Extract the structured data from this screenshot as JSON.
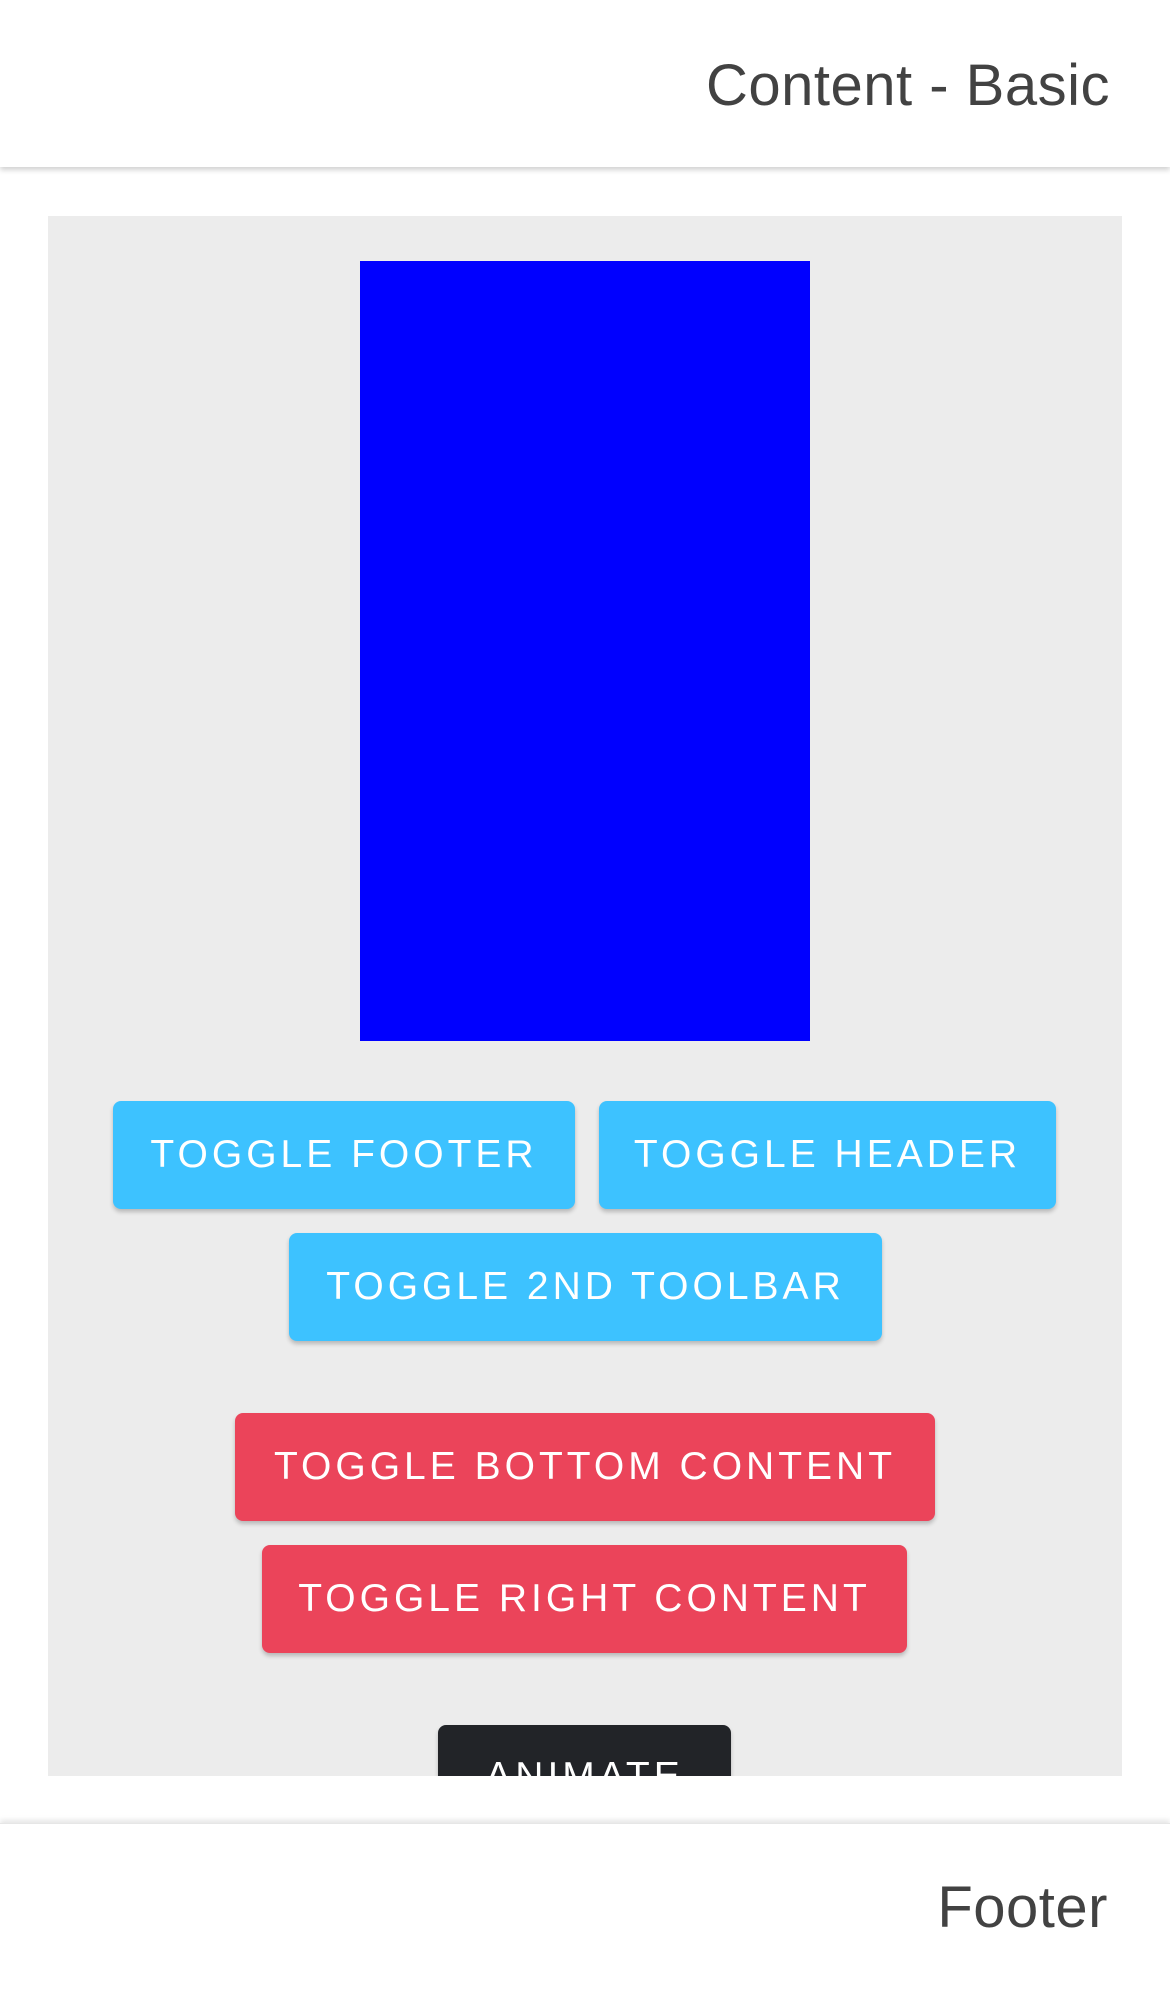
{
  "header": {
    "title": "Content - Basic"
  },
  "content": {
    "box_color": "#0000ff",
    "buttons": {
      "toggle_footer": "TOGGLE FOOTER",
      "toggle_header": "TOGGLE HEADER",
      "toggle_2nd_toolbar": "TOGGLE 2ND TOOLBAR",
      "toggle_bottom_content": "TOGGLE BOTTOM CONTENT",
      "toggle_right_content": "TOGGLE RIGHT CONTENT",
      "animate": "ANIMATE"
    }
  },
  "footer": {
    "title": "Footer"
  },
  "colors": {
    "primary_button": "#3dc2ff",
    "danger_button": "#eb445a",
    "dark_button": "#222428",
    "content_background": "#ececec"
  }
}
